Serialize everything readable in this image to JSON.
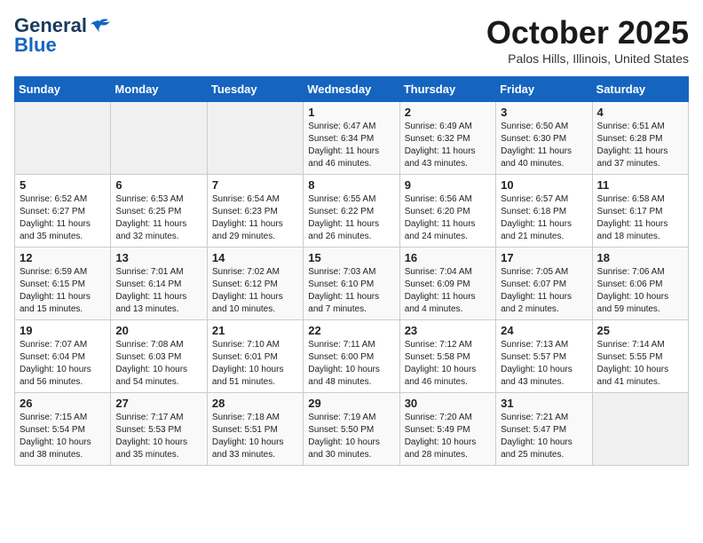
{
  "header": {
    "logo_general": "General",
    "logo_blue": "Blue",
    "month": "October 2025",
    "location": "Palos Hills, Illinois, United States"
  },
  "weekdays": [
    "Sunday",
    "Monday",
    "Tuesday",
    "Wednesday",
    "Thursday",
    "Friday",
    "Saturday"
  ],
  "weeks": [
    [
      {
        "day": "",
        "info": ""
      },
      {
        "day": "",
        "info": ""
      },
      {
        "day": "",
        "info": ""
      },
      {
        "day": "1",
        "info": "Sunrise: 6:47 AM\nSunset: 6:34 PM\nDaylight: 11 hours and 46 minutes."
      },
      {
        "day": "2",
        "info": "Sunrise: 6:49 AM\nSunset: 6:32 PM\nDaylight: 11 hours and 43 minutes."
      },
      {
        "day": "3",
        "info": "Sunrise: 6:50 AM\nSunset: 6:30 PM\nDaylight: 11 hours and 40 minutes."
      },
      {
        "day": "4",
        "info": "Sunrise: 6:51 AM\nSunset: 6:28 PM\nDaylight: 11 hours and 37 minutes."
      }
    ],
    [
      {
        "day": "5",
        "info": "Sunrise: 6:52 AM\nSunset: 6:27 PM\nDaylight: 11 hours and 35 minutes."
      },
      {
        "day": "6",
        "info": "Sunrise: 6:53 AM\nSunset: 6:25 PM\nDaylight: 11 hours and 32 minutes."
      },
      {
        "day": "7",
        "info": "Sunrise: 6:54 AM\nSunset: 6:23 PM\nDaylight: 11 hours and 29 minutes."
      },
      {
        "day": "8",
        "info": "Sunrise: 6:55 AM\nSunset: 6:22 PM\nDaylight: 11 hours and 26 minutes."
      },
      {
        "day": "9",
        "info": "Sunrise: 6:56 AM\nSunset: 6:20 PM\nDaylight: 11 hours and 24 minutes."
      },
      {
        "day": "10",
        "info": "Sunrise: 6:57 AM\nSunset: 6:18 PM\nDaylight: 11 hours and 21 minutes."
      },
      {
        "day": "11",
        "info": "Sunrise: 6:58 AM\nSunset: 6:17 PM\nDaylight: 11 hours and 18 minutes."
      }
    ],
    [
      {
        "day": "12",
        "info": "Sunrise: 6:59 AM\nSunset: 6:15 PM\nDaylight: 11 hours and 15 minutes."
      },
      {
        "day": "13",
        "info": "Sunrise: 7:01 AM\nSunset: 6:14 PM\nDaylight: 11 hours and 13 minutes."
      },
      {
        "day": "14",
        "info": "Sunrise: 7:02 AM\nSunset: 6:12 PM\nDaylight: 11 hours and 10 minutes."
      },
      {
        "day": "15",
        "info": "Sunrise: 7:03 AM\nSunset: 6:10 PM\nDaylight: 11 hours and 7 minutes."
      },
      {
        "day": "16",
        "info": "Sunrise: 7:04 AM\nSunset: 6:09 PM\nDaylight: 11 hours and 4 minutes."
      },
      {
        "day": "17",
        "info": "Sunrise: 7:05 AM\nSunset: 6:07 PM\nDaylight: 11 hours and 2 minutes."
      },
      {
        "day": "18",
        "info": "Sunrise: 7:06 AM\nSunset: 6:06 PM\nDaylight: 10 hours and 59 minutes."
      }
    ],
    [
      {
        "day": "19",
        "info": "Sunrise: 7:07 AM\nSunset: 6:04 PM\nDaylight: 10 hours and 56 minutes."
      },
      {
        "day": "20",
        "info": "Sunrise: 7:08 AM\nSunset: 6:03 PM\nDaylight: 10 hours and 54 minutes."
      },
      {
        "day": "21",
        "info": "Sunrise: 7:10 AM\nSunset: 6:01 PM\nDaylight: 10 hours and 51 minutes."
      },
      {
        "day": "22",
        "info": "Sunrise: 7:11 AM\nSunset: 6:00 PM\nDaylight: 10 hours and 48 minutes."
      },
      {
        "day": "23",
        "info": "Sunrise: 7:12 AM\nSunset: 5:58 PM\nDaylight: 10 hours and 46 minutes."
      },
      {
        "day": "24",
        "info": "Sunrise: 7:13 AM\nSunset: 5:57 PM\nDaylight: 10 hours and 43 minutes."
      },
      {
        "day": "25",
        "info": "Sunrise: 7:14 AM\nSunset: 5:55 PM\nDaylight: 10 hours and 41 minutes."
      }
    ],
    [
      {
        "day": "26",
        "info": "Sunrise: 7:15 AM\nSunset: 5:54 PM\nDaylight: 10 hours and 38 minutes."
      },
      {
        "day": "27",
        "info": "Sunrise: 7:17 AM\nSunset: 5:53 PM\nDaylight: 10 hours and 35 minutes."
      },
      {
        "day": "28",
        "info": "Sunrise: 7:18 AM\nSunset: 5:51 PM\nDaylight: 10 hours and 33 minutes."
      },
      {
        "day": "29",
        "info": "Sunrise: 7:19 AM\nSunset: 5:50 PM\nDaylight: 10 hours and 30 minutes."
      },
      {
        "day": "30",
        "info": "Sunrise: 7:20 AM\nSunset: 5:49 PM\nDaylight: 10 hours and 28 minutes."
      },
      {
        "day": "31",
        "info": "Sunrise: 7:21 AM\nSunset: 5:47 PM\nDaylight: 10 hours and 25 minutes."
      },
      {
        "day": "",
        "info": ""
      }
    ]
  ]
}
